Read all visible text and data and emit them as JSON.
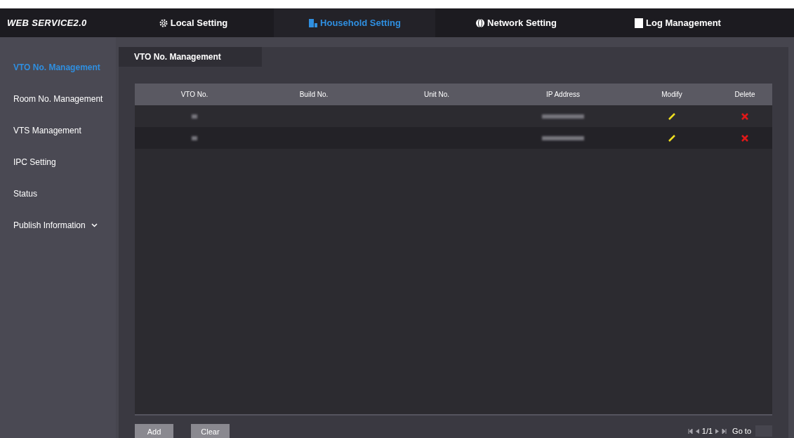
{
  "header": {
    "logo": "WEB SERVICE2.0",
    "tabs": [
      {
        "label": "Local Setting",
        "selected": false
      },
      {
        "label": "Household Setting",
        "selected": true
      },
      {
        "label": "Network Setting",
        "selected": false
      },
      {
        "label": "Log Management",
        "selected": false
      }
    ]
  },
  "sidebar": {
    "items": [
      {
        "label": "VTO No. Management",
        "selected": true,
        "kind": "link"
      },
      {
        "label": "Room No. Management",
        "selected": false,
        "kind": "link"
      },
      {
        "label": "VTS Management",
        "selected": false,
        "kind": "link"
      },
      {
        "label": "IPC Setting",
        "selected": false,
        "kind": "link"
      },
      {
        "label": "Status",
        "selected": false,
        "kind": "link"
      },
      {
        "label": "Publish Information",
        "selected": false,
        "kind": "group"
      }
    ]
  },
  "page_tabs": [
    {
      "label": "VTO No. Management",
      "selected": true
    }
  ],
  "table": {
    "columns": [
      "VTO No.",
      "Build No.",
      "Unit No.",
      "IP Address",
      "Modify",
      "Delete"
    ],
    "rows": [
      {
        "kind": "redacted"
      },
      {
        "kind": "redacted"
      }
    ]
  },
  "buttons": [
    "Add",
    "Clear"
  ],
  "pagination": {
    "page": "1/1",
    "goto_label": "Go to"
  }
}
